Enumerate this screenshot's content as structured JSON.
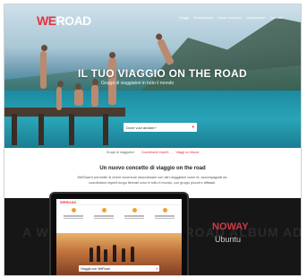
{
  "brand": {
    "logo_we": "WE",
    "logo_road": "ROAD"
  },
  "nav": {
    "items": [
      "Viaggi",
      "Destinazioni",
      "Come funziona",
      "Coordinatori",
      "Contatti"
    ]
  },
  "hero": {
    "title": "IL TUO VIAGGIO ON THE ROAD",
    "subtitle": "Gruppi di viaggiatori in tutto il mondo",
    "search_placeholder": "Dove vuoi andare?"
  },
  "strip": {
    "items": [
      "Gruppi di viaggiatori",
      "Coordinatori esperti",
      "Viaggi su misura"
    ]
  },
  "intro": {
    "title": "Un nuovo concetto di viaggio on the road",
    "text": "WeRoad ti permette di vivere avventure straordinarie con altri viaggiatori come te, accompagnati da coordinatori esperti lungo itinerari unici in tutto il mondo, con gruppi piccoli e affiatati."
  },
  "promo": {
    "ghost_text": "A WE ROAD ALLIN THE ROAD ALBUM ADDRESS",
    "highlight": "NOWAY",
    "font_name": "Ubuntu"
  },
  "mockup": {
    "logo": "WEROAD",
    "search_text": "Viaggia con WeRoad"
  },
  "colors": {
    "accent": "#e8323c",
    "dark": "#161616"
  }
}
